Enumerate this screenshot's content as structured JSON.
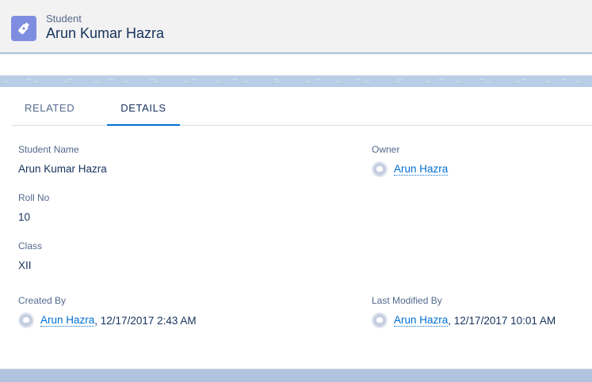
{
  "header": {
    "object_label": "Student",
    "record_title": "Arun Kumar Hazra",
    "icon": "bottle-icon",
    "icon_color": "#7f8de1"
  },
  "tabs": [
    {
      "label": "RELATED",
      "active": false
    },
    {
      "label": "DETAILS",
      "active": true
    }
  ],
  "fields": {
    "student_name": {
      "label": "Student Name",
      "value": "Arun Kumar Hazra"
    },
    "owner": {
      "label": "Owner",
      "user": "Arun Hazra"
    },
    "roll_no": {
      "label": "Roll No",
      "value": "10"
    },
    "class": {
      "label": "Class",
      "value": "XII"
    },
    "created_by": {
      "label": "Created By",
      "user": "Arun Hazra",
      "timestamp": ", 12/17/2017 2:43 AM"
    },
    "last_modified_by": {
      "label": "Last Modified By",
      "user": "Arun Hazra",
      "timestamp": ", 12/17/2017 10:01 AM"
    }
  },
  "colors": {
    "link": "#0070d2",
    "tab_active_underline": "#0070d2",
    "background": "#b0c4df"
  }
}
